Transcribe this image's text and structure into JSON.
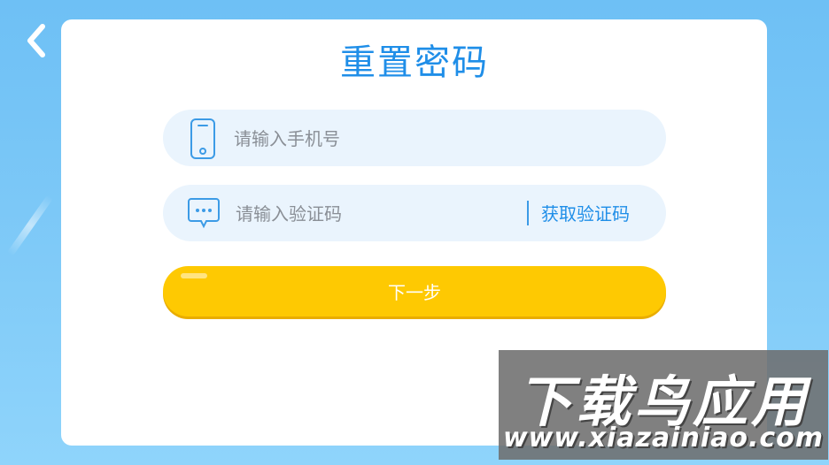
{
  "page": {
    "title": "重置密码"
  },
  "phone_field": {
    "placeholder": "请输入手机号",
    "icon": "smartphone-icon"
  },
  "code_field": {
    "placeholder": "请输入验证码",
    "icon": "message-icon",
    "get_code_label": "获取验证码"
  },
  "next_button": {
    "label": "下一步"
  },
  "back_button": {
    "icon": "chevron-left-icon"
  },
  "watermark": {
    "brand": "下载鸟应用",
    "url": "www.xiazainiao.com"
  },
  "colors": {
    "background": "#7cc8f7",
    "accent": "#1f8ee8",
    "field_bg": "#eaf4fd",
    "button": "#fec902"
  }
}
